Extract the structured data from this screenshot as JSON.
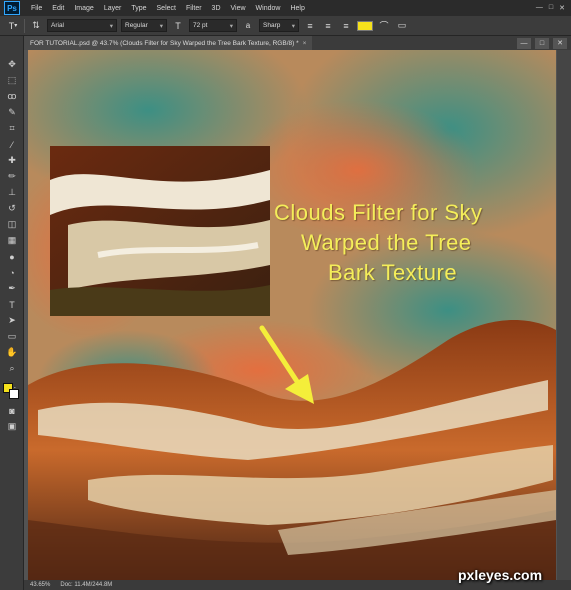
{
  "app": {
    "logo": "Ps"
  },
  "menu": [
    "File",
    "Edit",
    "Image",
    "Layer",
    "Type",
    "Select",
    "Filter",
    "3D",
    "View",
    "Window",
    "Help"
  ],
  "window_controls": [
    "—",
    "□",
    "✕"
  ],
  "options_bar": {
    "font_family": "Arial",
    "font_style": "Regular",
    "font_size": "72 pt",
    "anti_alias": "Sharp",
    "text_color": "#f5e11c"
  },
  "document_tab": {
    "title": "FOR TUTORIAL.psd @ 43.7% (Clouds Filter for Sky Warped the Tree Bark Texture, RGB/8) *",
    "close": "×"
  },
  "canvas_caption": [
    "Clouds Filter for Sky",
    "Warped the Tree",
    "Bark Texture"
  ],
  "status_bar": {
    "zoom": "43.65%",
    "doc_info": "Doc: 11.4M/244.8M"
  },
  "watermark": "pxleyes.com",
  "colors": {
    "foreground": "#f5e11c",
    "background": "#ffffff",
    "caption_text": "#f4ee5a",
    "arrow": "#f4ee3a"
  }
}
